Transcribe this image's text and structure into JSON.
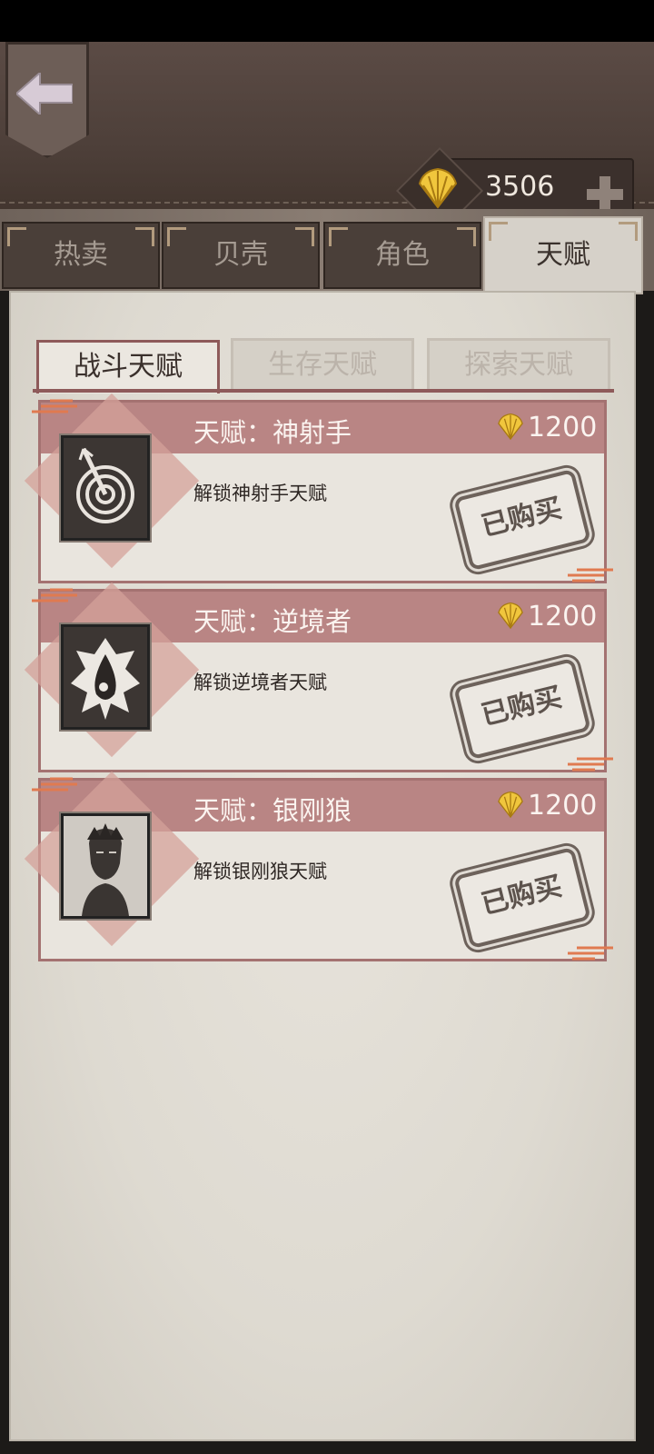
{
  "header": {
    "currency_amount": "3506"
  },
  "tabs": [
    {
      "label": "热卖",
      "active": false
    },
    {
      "label": "贝壳",
      "active": false
    },
    {
      "label": "角色",
      "active": false
    },
    {
      "label": "天赋",
      "active": true
    }
  ],
  "sub_tabs": [
    {
      "label": "战斗天赋",
      "active": true
    },
    {
      "label": "生存天赋",
      "active": false
    },
    {
      "label": "探索天赋",
      "active": false
    }
  ],
  "cards": [
    {
      "name": "天赋：神射手",
      "cost": "1200",
      "desc": "解锁神射手天赋",
      "status": "已购买",
      "icon": "target-arrow-icon"
    },
    {
      "name": "天赋：逆境者",
      "cost": "1200",
      "desc": "解锁逆境者天赋",
      "status": "已购买",
      "icon": "blood-drop-icon"
    },
    {
      "name": "天赋：银刚狼",
      "cost": "1200",
      "desc": "解锁银刚狼天赋",
      "status": "已购买",
      "icon": "wolverine-portrait-icon"
    }
  ],
  "colors": {
    "accent": "#b98584",
    "parchment": "#e3dfd7",
    "header": "#4e403a"
  }
}
